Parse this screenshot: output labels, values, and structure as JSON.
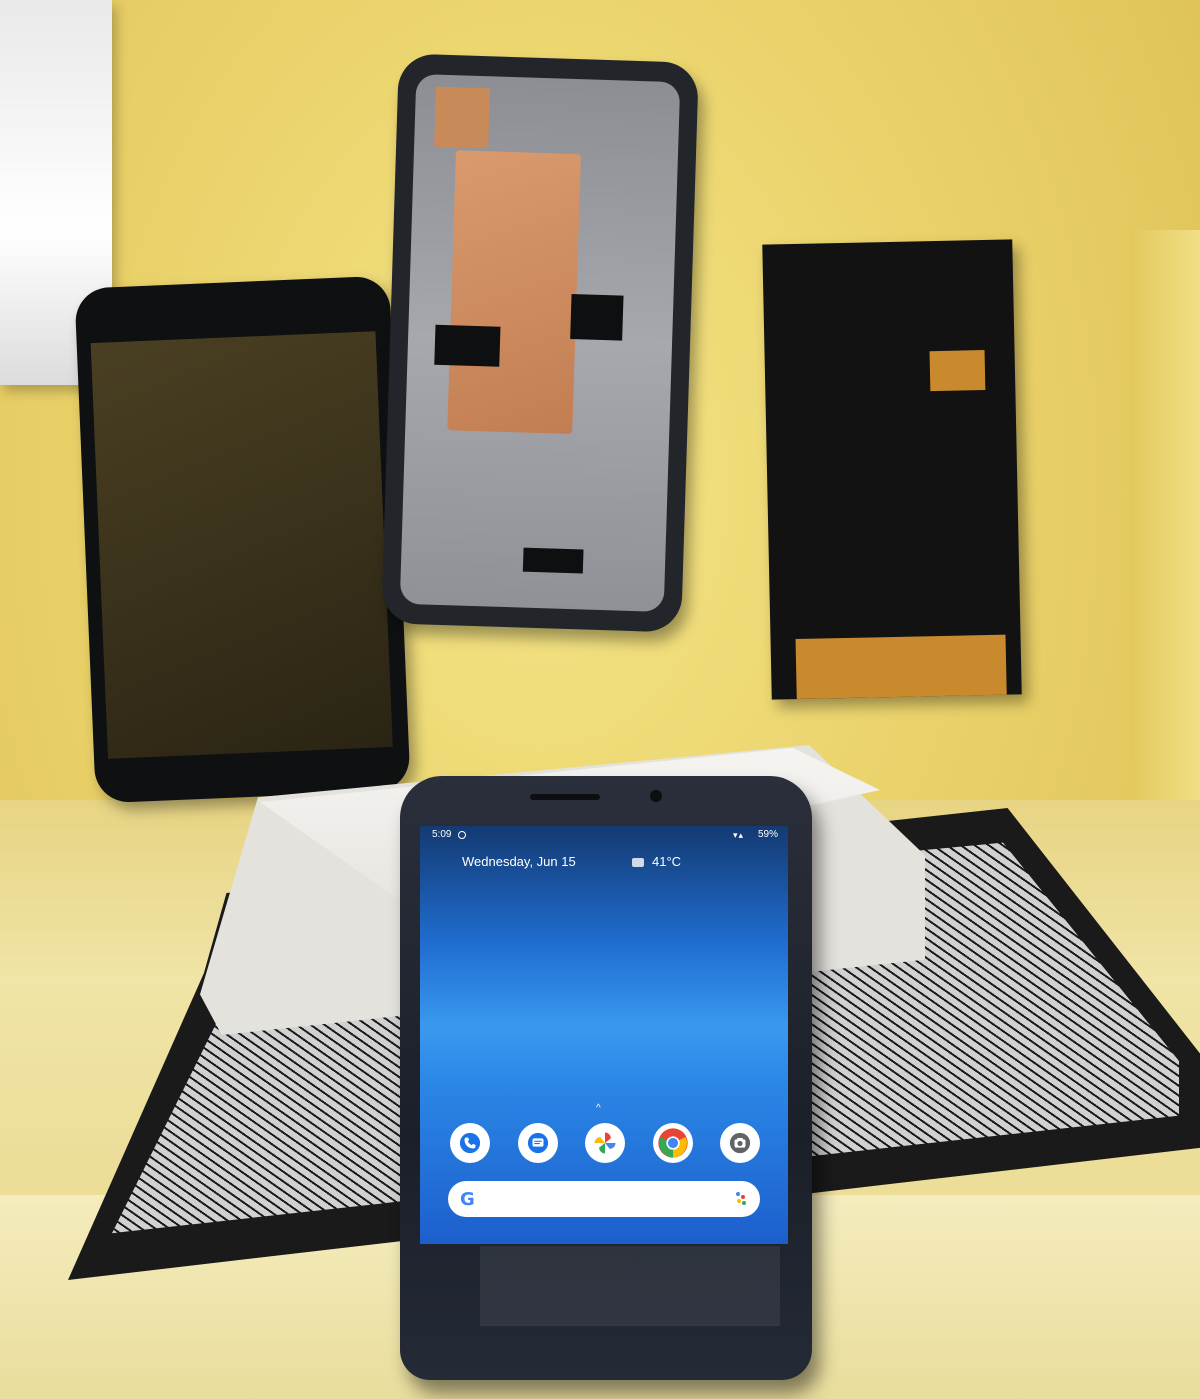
{
  "phone_screen": {
    "status_time": "5:09",
    "status_battery": "59%",
    "date": "Wednesday, Jun 15",
    "temperature": "41°C",
    "dock_apps": [
      {
        "name": "phone-icon",
        "color": "#1a73e8"
      },
      {
        "name": "messages-icon",
        "color": "#1a73e8"
      },
      {
        "name": "photos-icon",
        "color": "#fbbc04"
      },
      {
        "name": "chrome-icon",
        "color": "#ea4335"
      },
      {
        "name": "camera-icon",
        "color": "#3c4043"
      }
    ],
    "search_logo": "G"
  },
  "colors": {
    "wall": "#ead26a",
    "screen_blue": "#2b86e6",
    "copper": "#c98a5a",
    "flex_cable": "#c88a2c"
  }
}
